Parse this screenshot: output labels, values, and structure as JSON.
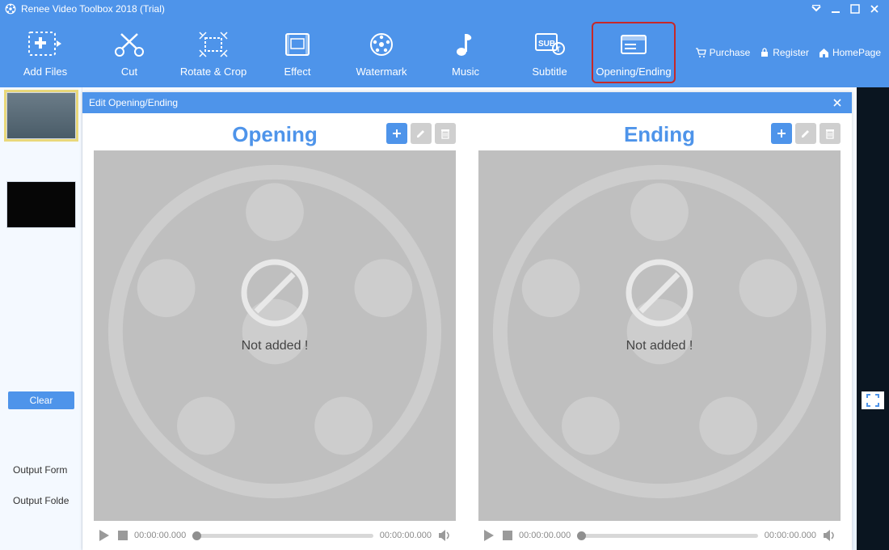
{
  "title": "Renee Video Toolbox 2018 (Trial)",
  "toolbar": {
    "add_files": "Add Files",
    "cut": "Cut",
    "rotate_crop": "Rotate & Crop",
    "effect": "Effect",
    "watermark": "Watermark",
    "music": "Music",
    "subtitle": "Subtitle",
    "opening_ending": "Opening/Ending"
  },
  "header_links": {
    "purchase": "Purchase",
    "register": "Register",
    "homepage": "HomePage"
  },
  "left_panel": {
    "clear": "Clear",
    "output_format": "Output Form",
    "output_folder": "Output Folde"
  },
  "modal": {
    "title": "Edit Opening/Ending",
    "opening": {
      "title": "Opening",
      "placeholder": "Not added !",
      "time_start": "00:00:00.000",
      "time_end": "00:00:00.000"
    },
    "ending": {
      "title": "Ending",
      "placeholder": "Not added !",
      "time_start": "00:00:00.000",
      "time_end": "00:00:00.000"
    }
  }
}
